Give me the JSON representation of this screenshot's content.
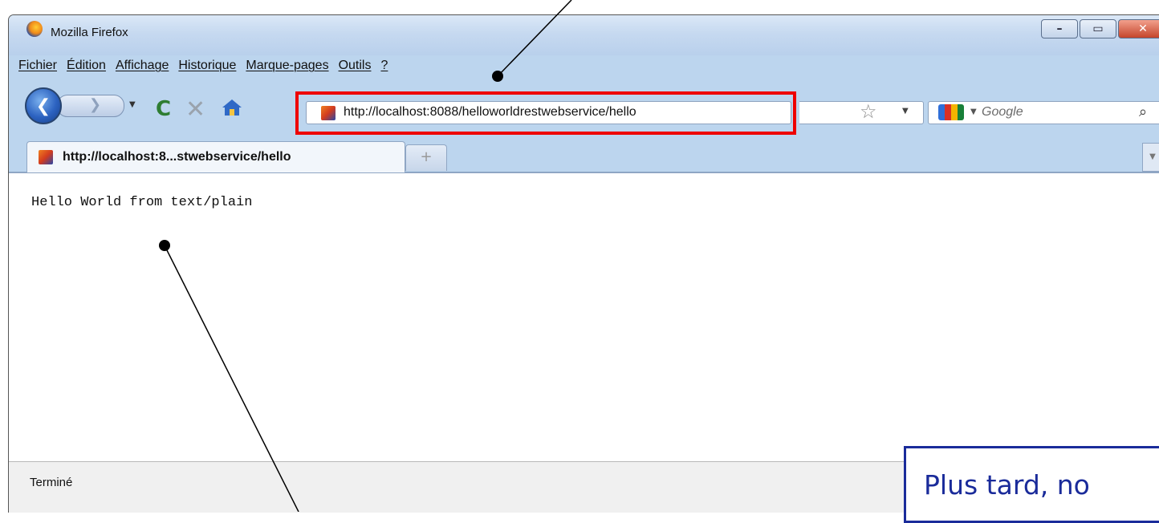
{
  "window": {
    "title": "Mozilla Firefox",
    "controls": [
      "minimize",
      "maximize",
      "close"
    ]
  },
  "menu": {
    "items": [
      {
        "label": "Fichier"
      },
      {
        "label": "Édition"
      },
      {
        "label": "Affichage"
      },
      {
        "label": "Historique"
      },
      {
        "label": "Marque-pages"
      },
      {
        "label": "Outils"
      },
      {
        "label": "?"
      }
    ]
  },
  "navbar": {
    "url": "http://localhost:8088/helloworldrestwebservice/hello",
    "search_placeholder": "Google"
  },
  "tabs": [
    {
      "label": "http://localhost:8...stwebservice/hello",
      "active": true
    }
  ],
  "content": {
    "text": "Hello World from text/plain"
  },
  "status": {
    "text": "Terminé"
  },
  "callout": {
    "text": "Plus tard, no"
  },
  "colors": {
    "highlight": "#ee0000",
    "callout": "#1a2b9a"
  }
}
